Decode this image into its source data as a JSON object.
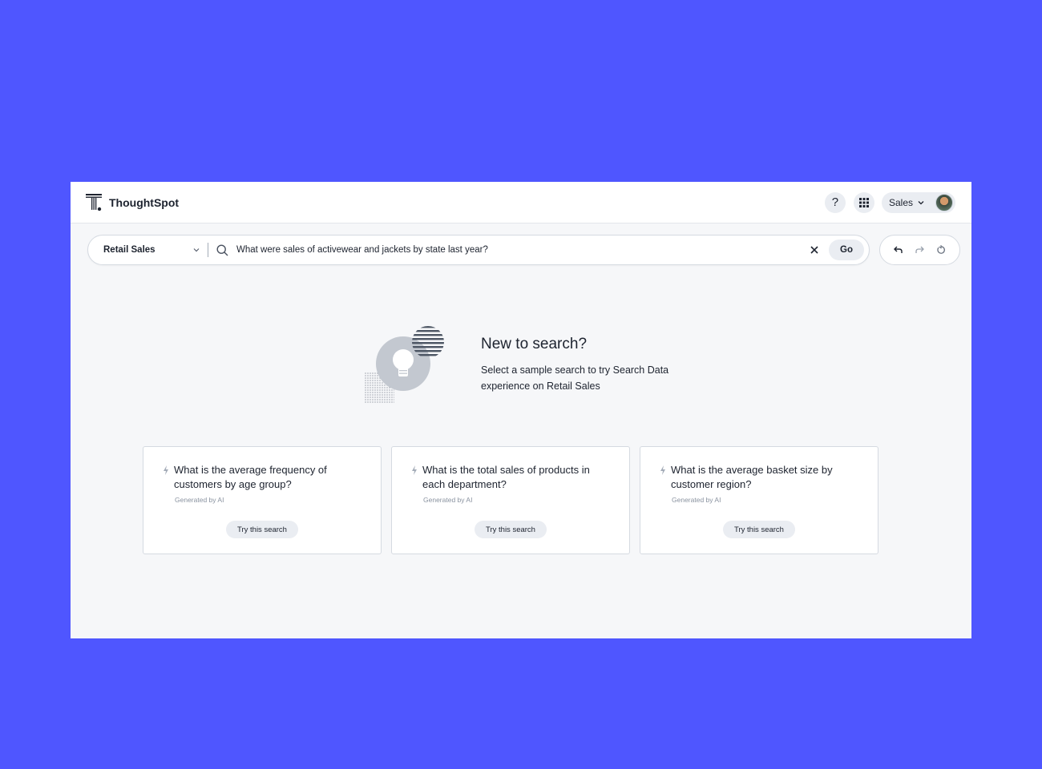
{
  "app": {
    "name": "ThoughtSpot"
  },
  "header": {
    "org_label": "Sales"
  },
  "search": {
    "datasource": "Retail Sales",
    "query": "What were sales of activewear and jackets by state last year?",
    "go_label": "Go"
  },
  "hero": {
    "title": "New to search?",
    "description": "Select a sample search to try Search Data experience on Retail Sales"
  },
  "cards": [
    {
      "question": "What is the average frequency of customers by age group?",
      "generated": "Generated by AI",
      "action": "Try this search"
    },
    {
      "question": "What is the total sales of products in each department?",
      "generated": "Generated by AI",
      "action": "Try this search"
    },
    {
      "question": "What is the average basket size by customer region?",
      "generated": "Generated by AI",
      "action": "Try this search"
    }
  ],
  "colors": {
    "background": "#4f56ff",
    "window": "#f6f7f9",
    "text": "#1d232f",
    "pill": "#eaedf2"
  }
}
